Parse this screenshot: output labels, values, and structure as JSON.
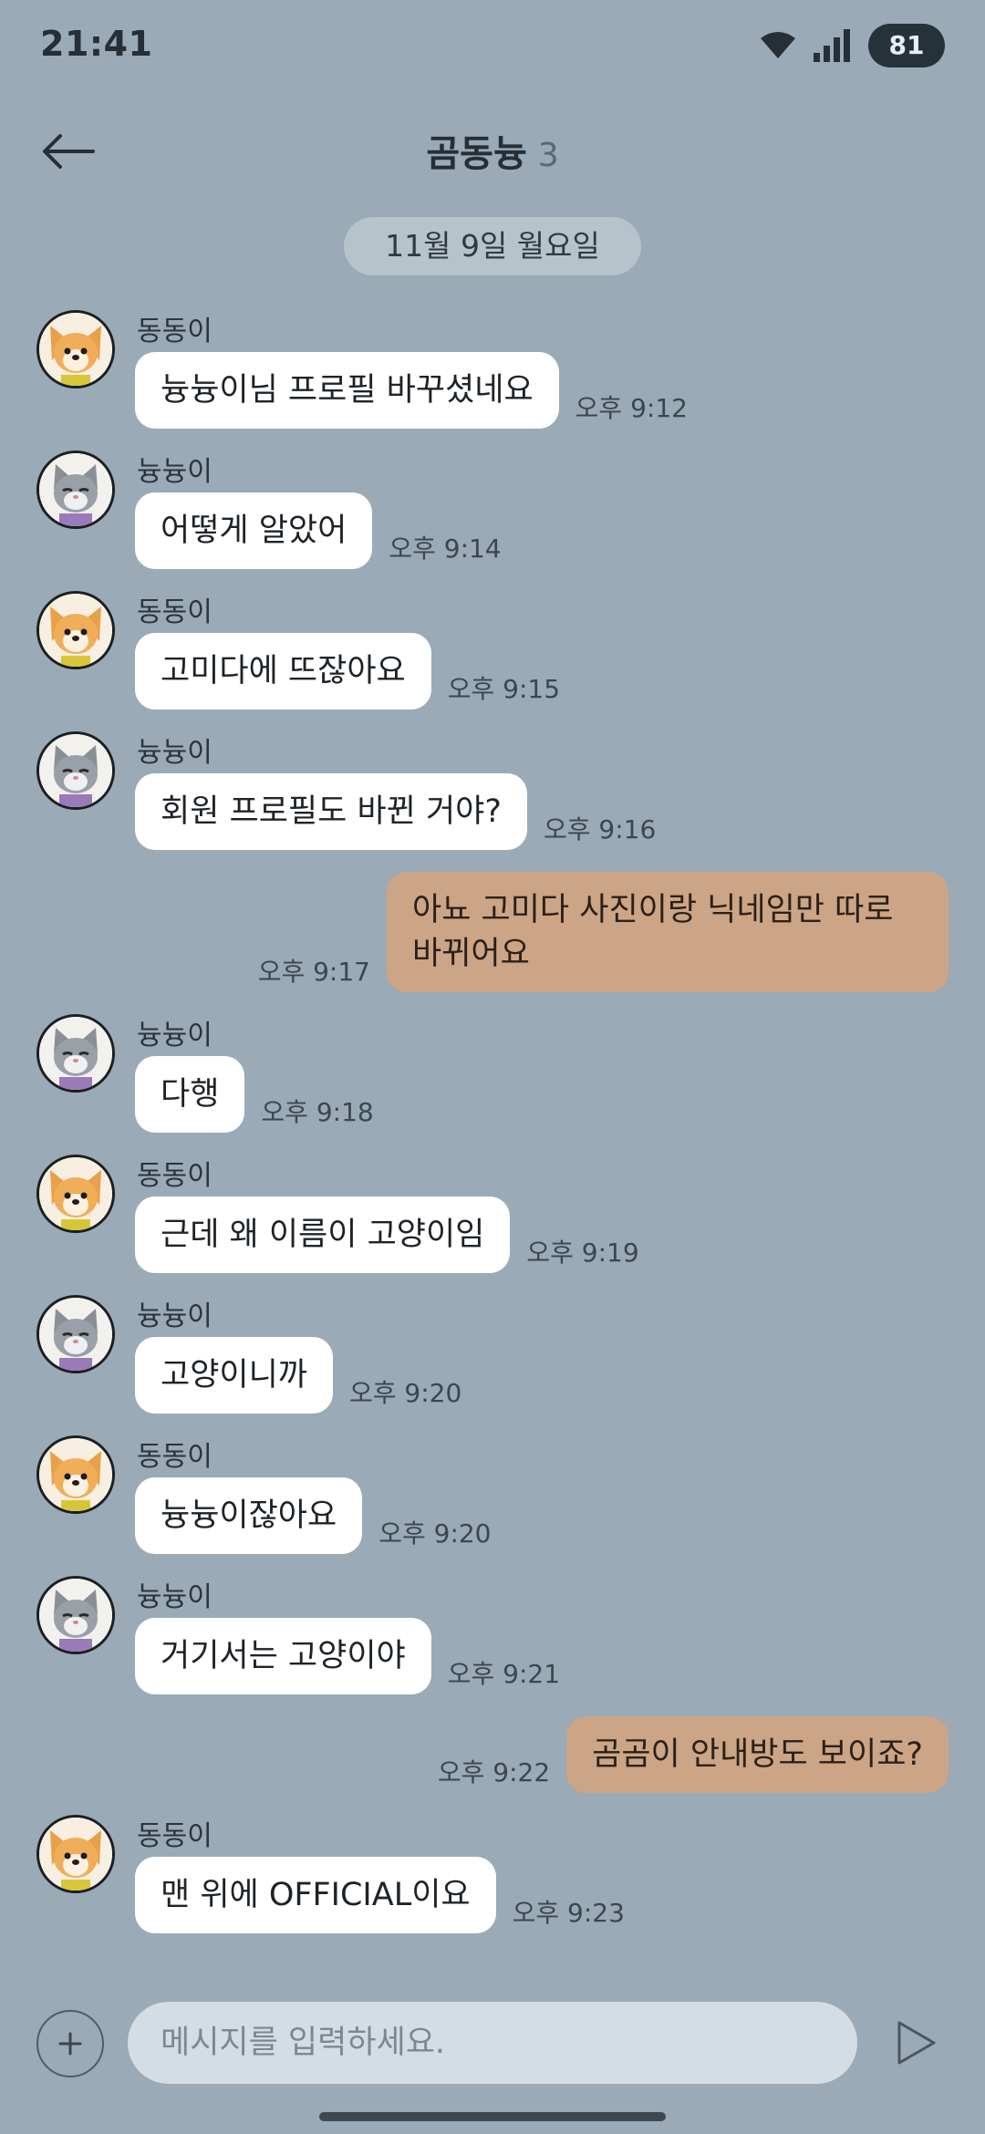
{
  "status_bar": {
    "time": "21:41",
    "battery": "81",
    "icons": [
      "wifi-icon",
      "signal-icon"
    ]
  },
  "header": {
    "title": "곰동늉",
    "member_count": "3",
    "back_icon": "arrow-left-icon"
  },
  "date_divider": "11월 9일 월요일",
  "senders": {
    "dongdong": {
      "name": "동동이",
      "avatar": "corgi-avatar"
    },
    "nyunyu": {
      "name": "늉늉이",
      "avatar": "cat-avatar"
    }
  },
  "messages": [
    {
      "sender": "동동이",
      "text": "늉늉이님 프로필 바꾸셨네요",
      "time": "오후 9:12"
    },
    {
      "sender": "늉늉이",
      "text": "어떻게 알았어",
      "time": "오후 9:14"
    },
    {
      "sender": "동동이",
      "text": "고미다에 뜨잖아요",
      "time": "오후 9:15"
    },
    {
      "sender": "늉늉이",
      "text": "회원 프로필도 바뀐 거야?",
      "time": "오후 9:16"
    },
    {
      "sender": "me",
      "text": "아뇨 고미다 사진이랑 닉네임만 따로 바뀌어요",
      "time": "오후 9:17"
    },
    {
      "sender": "늉늉이",
      "text": "다행",
      "time": "오후 9:18"
    },
    {
      "sender": "동동이",
      "text": "근데 왜 이름이 고양이임",
      "time": "오후 9:19"
    },
    {
      "sender": "늉늉이",
      "text": "고양이니까",
      "time": "오후 9:20"
    },
    {
      "sender": "동동이",
      "text": "늉늉이잖아요",
      "time": "오후 9:20"
    },
    {
      "sender": "늉늉이",
      "text": "거기서는 고양이야",
      "time": "오후 9:21"
    },
    {
      "sender": "me",
      "text": "곰곰이 안내방도 보이죠?",
      "time": "오후 9:22"
    },
    {
      "sender": "동동이",
      "text": "맨 위에 OFFICIAL이요",
      "time": "오후 9:23"
    }
  ],
  "input": {
    "placeholder": "메시지를 입력하세요.",
    "value": "",
    "plus_icon": "plus-icon",
    "send_icon": "send-icon"
  },
  "colors": {
    "background": "#9aaab6",
    "incoming_bubble": "#ffffff",
    "outgoing_bubble": "#cca586",
    "date_pill": "#b7c3cb",
    "battery_badge": "#26323a"
  }
}
